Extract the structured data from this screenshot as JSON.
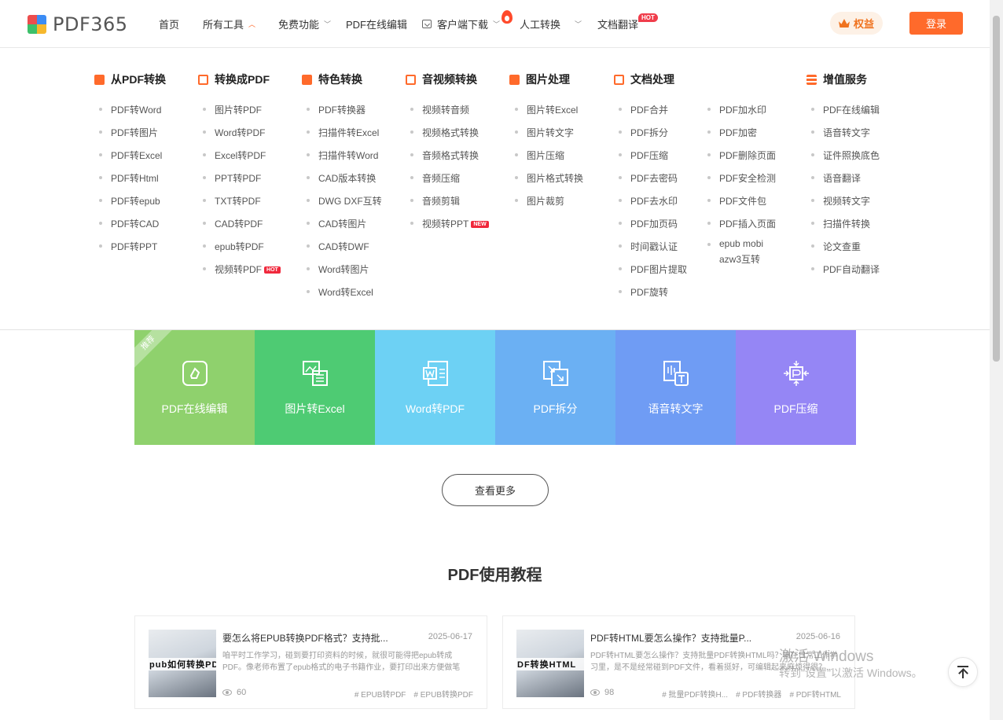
{
  "logo": {
    "text": "PDF365"
  },
  "nav": {
    "home": "首页",
    "all_tools": "所有工具",
    "free": "免费功能",
    "online_edit": "PDF在线编辑",
    "download": "客户端下载",
    "manual": "人工转换",
    "translate": "文档翻译",
    "hot_badge": "HOT"
  },
  "header": {
    "rights": "权益",
    "login": "登录"
  },
  "menu": {
    "columns": [
      {
        "title": "从PDF转换",
        "items": [
          "PDF转Word",
          "PDF转图片",
          "PDF转Excel",
          "PDF转Html",
          "PDF转epub",
          "PDF转CAD",
          "PDF转PPT"
        ]
      },
      {
        "title": "转换成PDF",
        "items": [
          "图片转PDF",
          "Word转PDF",
          "Excel转PDF",
          "PPT转PDF",
          "TXT转PDF",
          "CAD转PDF",
          "epub转PDF",
          "视频转PDF"
        ],
        "tag": "HOT"
      },
      {
        "title": "特色转换",
        "items": [
          "PDF转换器",
          "扫描件转Excel",
          "扫描件转Word",
          "CAD版本转换",
          "DWG DXF互转",
          "CAD转图片",
          "CAD转DWF",
          "Word转图片",
          "Word转Excel"
        ]
      },
      {
        "title": "音视频转换",
        "items": [
          "视频转音频",
          "视频格式转换",
          "音频格式转换",
          "音频压缩",
          "音频剪辑",
          "视频转PPT"
        ],
        "tag": "NEW"
      },
      {
        "title": "图片处理",
        "items": [
          "图片转Excel",
          "图片转文字",
          "图片压缩",
          "图片格式转换",
          "图片裁剪"
        ]
      },
      {
        "title": "文档处理",
        "items": [
          "PDF合并",
          "PDF拆分",
          "PDF压缩",
          "PDF去密码",
          "PDF去水印",
          "PDF加页码",
          "时间戳认证",
          "PDF图片提取",
          "PDF旋转"
        ]
      },
      {
        "title": "",
        "items": [
          "PDF加水印",
          "PDF加密",
          "PDF删除页面",
          "PDF安全检测",
          "PDF文件包",
          "PDF插入页面",
          "epub mobi azw3互转"
        ]
      },
      {
        "title": "增值服务",
        "items": [
          "PDF在线编辑",
          "语音转文字",
          "证件照换底色",
          "语音翻译",
          "视频转文字",
          "扫描件转换",
          "论文查重",
          "PDF自动翻译"
        ]
      }
    ]
  },
  "tiles": [
    {
      "label": "PDF在线编辑",
      "color": "#8fd16d",
      "icon": "edit-icon",
      "ribbon": "推荐"
    },
    {
      "label": "图片转Excel",
      "color": "#4ecb73",
      "icon": "image-excel-icon"
    },
    {
      "label": "Word转PDF",
      "color": "#6dd1f4",
      "icon": "word-icon"
    },
    {
      "label": "PDF拆分",
      "color": "#6bb0f3",
      "icon": "split-icon"
    },
    {
      "label": "语音转文字",
      "color": "#6f9cf4",
      "icon": "voice-text-icon"
    },
    {
      "label": "PDF压缩",
      "color": "#9586f5",
      "icon": "compress-icon"
    }
  ],
  "more_button": "查看更多",
  "tutorial": {
    "title": "PDF使用教程",
    "cards": [
      {
        "title": "要怎么将EPUB转换PDF格式？支持批...",
        "date": "2025-06-17",
        "desc": "咱平时工作学习，碰到要打印资料的时候，就很可能得把epub转成PDF。像老师布置了epub格式的电子书籍作业，要打印出来方便做笔记...",
        "views": "60",
        "tags": [
          "# EPUB转PDF",
          "# EPUB转换PDF"
        ],
        "thumb_caption": "pub如何转换PDF"
      },
      {
        "title": "PDF转HTML要怎么操作？支持批量P...",
        "date": "2025-06-16",
        "desc": "PDF转HTML要怎么操作？支持批量PDF转换HTML吗？咱在日常工作学习里，是不是经常碰到PDF文件，看着挺好，可编辑起来麻烦得很？...",
        "views": "98",
        "tags": [
          "# 批量PDF转换H...",
          "# PDF转换器",
          "# PDF转HTML"
        ],
        "thumb_caption": "DF转换HTML"
      }
    ]
  },
  "watermark": {
    "line1": "激活 Windows",
    "line2": "转到\"设置\"以激活 Windows。"
  }
}
